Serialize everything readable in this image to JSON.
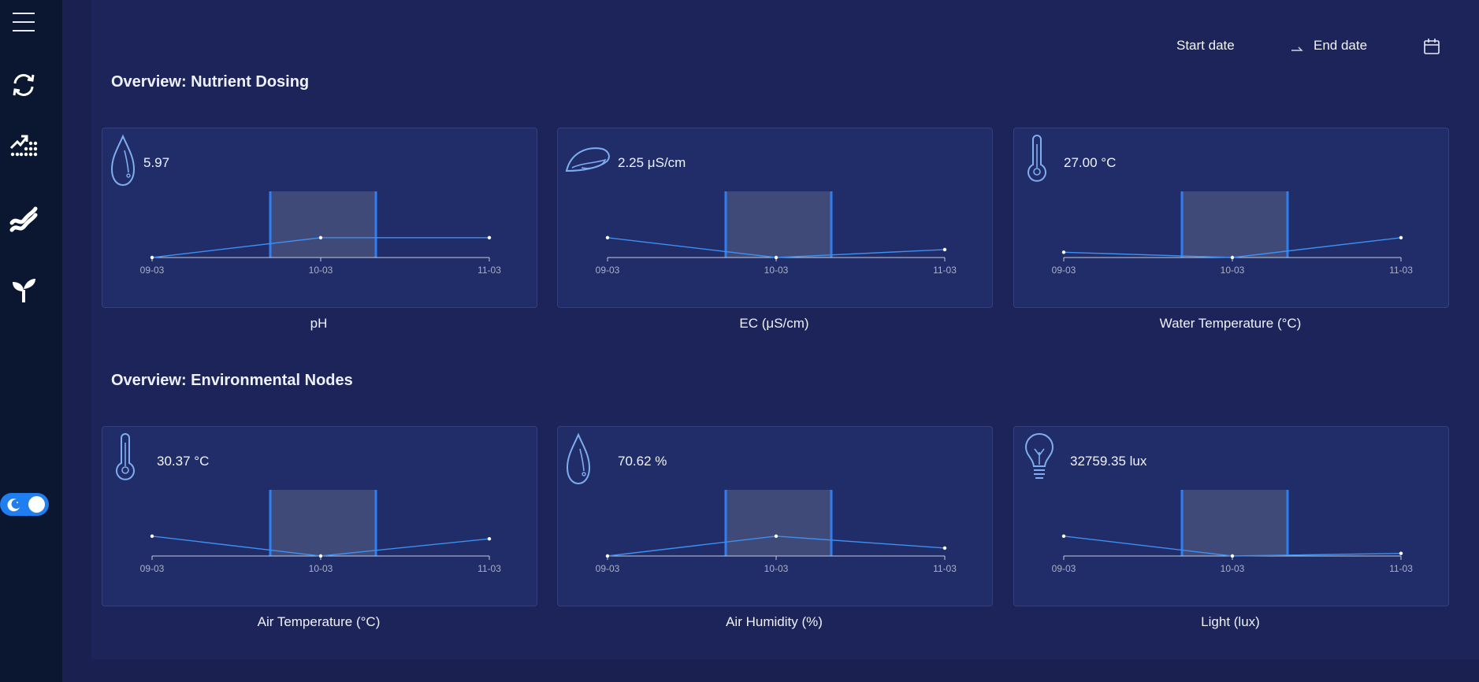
{
  "header": {
    "start_date": "Start date",
    "end_date": "End date"
  },
  "sidebar": {
    "items": [
      {
        "icon": "menu-icon"
      },
      {
        "icon": "refresh-icon"
      },
      {
        "icon": "trend-dots-icon"
      },
      {
        "icon": "wave-icon"
      },
      {
        "icon": "sprout-icon"
      }
    ],
    "theme_toggle": {
      "state": "dark",
      "icon": "moon-icon"
    }
  },
  "sections": [
    {
      "title": "Overview: Nutrient Dosing",
      "cards": [
        {
          "icon": "droplet-icon",
          "value": "5.97",
          "caption": "pH",
          "points": [
            0,
            0.3,
            0.3
          ]
        },
        {
          "icon": "leaf-icon",
          "value": "2.25 μS/cm",
          "caption": "EC (μS/cm)",
          "points": [
            0.3,
            0,
            0.12
          ]
        },
        {
          "icon": "thermometer-icon",
          "value": "27.00 °C",
          "caption": "Water Temperature (°C)",
          "points": [
            0.08,
            0,
            0.3
          ]
        }
      ]
    },
    {
      "title": "Overview: Environmental Nodes",
      "cards": [
        {
          "icon": "thermometer-icon",
          "value": "30.37 °C",
          "caption": "Air Temperature (°C)",
          "points": [
            0.3,
            0,
            0.26
          ]
        },
        {
          "icon": "droplet-icon",
          "value": "70.62 %",
          "caption": "Air Humidity (%)",
          "points": [
            0,
            0.3,
            0.12
          ]
        },
        {
          "icon": "lightbulb-icon",
          "value": "32759.35 lux",
          "caption": "Light (lux)",
          "points": [
            0.3,
            0,
            0.04
          ]
        }
      ]
    }
  ],
  "chart_data": {
    "type": "line",
    "x": [
      "09-03",
      "10-03",
      "11-03"
    ],
    "highlight_range": [
      "10-03 (before)",
      "10-03 (after)"
    ],
    "series_note_colors": {
      "line": "#3d8ff0",
      "highlight_fill": "#404a78",
      "highlight_edge": "#2f7ff0"
    }
  },
  "colors": {
    "sidebar_bg": "#0b1630",
    "page_bg": "#1a2050",
    "card_bg": "#212d68",
    "accent": "#1f7ef0",
    "icon_stroke": "#7eaef0"
  }
}
